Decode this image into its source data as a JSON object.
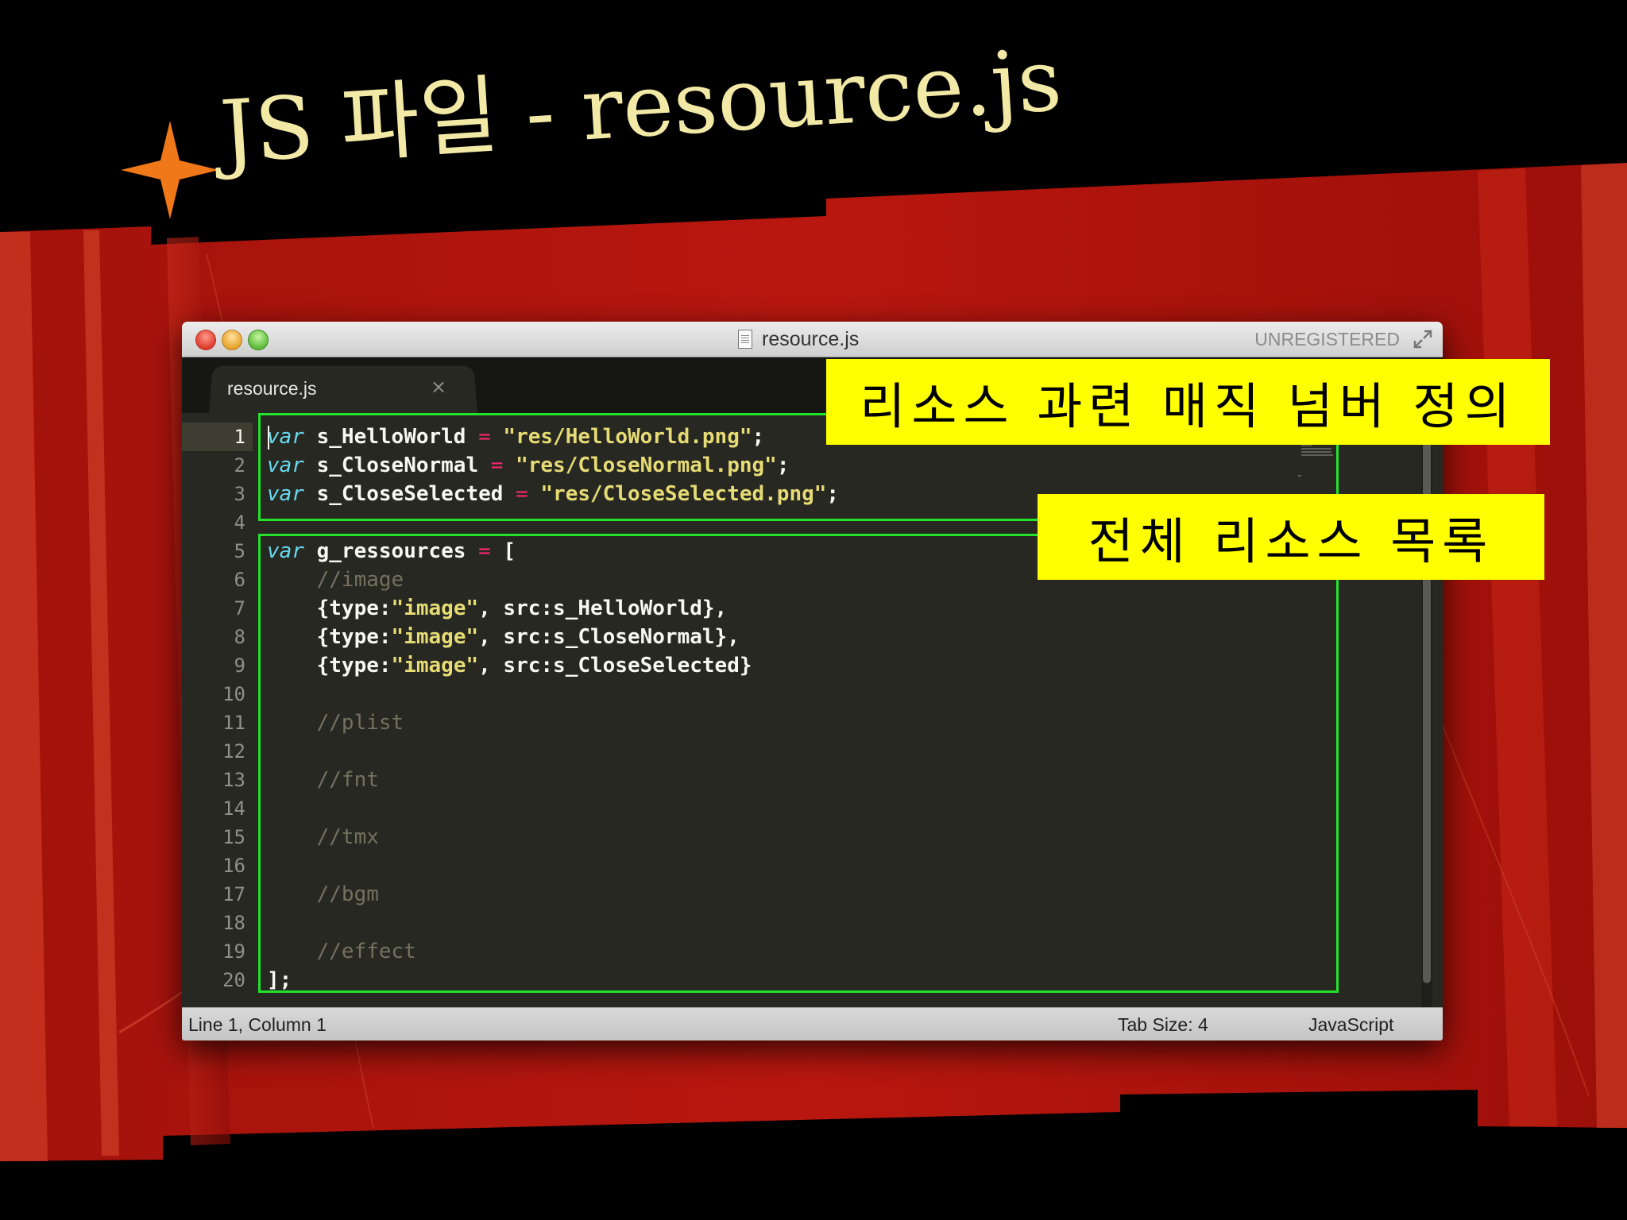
{
  "slide": {
    "title": "JS 파일 - resource.js"
  },
  "window": {
    "title": "resource.js",
    "registration": "UNREGISTERED"
  },
  "tab": {
    "label": "resource.js",
    "close": "×"
  },
  "editor": {
    "line_numbers": [
      "1",
      "2",
      "3",
      "4",
      "5",
      "6",
      "7",
      "8",
      "9",
      "10",
      "11",
      "12",
      "13",
      "14",
      "15",
      "16",
      "17",
      "18",
      "19",
      "20"
    ],
    "current_line": 1
  },
  "code": {
    "l1": {
      "kw": "var",
      "name": " s_HelloWorld ",
      "eq": "=",
      "str": " \"res/HelloWorld.png\"",
      "end": ";"
    },
    "l2": {
      "kw": "var",
      "name": " s_CloseNormal ",
      "eq": "=",
      "str": " \"res/CloseNormal.png\"",
      "end": ";"
    },
    "l3": {
      "kw": "var",
      "name": " s_CloseSelected ",
      "eq": "=",
      "str": " \"res/CloseSelected.png\"",
      "end": ";"
    },
    "l5": {
      "kw": "var",
      "name": " g_ressources ",
      "eq": "=",
      "end": " ["
    },
    "l6": "    //image",
    "l7": {
      "pre": "    {type:",
      "str": "\"image\"",
      "post": ", src:s_HelloWorld},"
    },
    "l8": {
      "pre": "    {type:",
      "str": "\"image\"",
      "post": ", src:s_CloseNormal},"
    },
    "l9": {
      "pre": "    {type:",
      "str": "\"image\"",
      "post": ", src:s_CloseSelected}"
    },
    "l11": "    //plist",
    "l13": "    //fnt",
    "l15": "    //tmx",
    "l17": "    //bgm",
    "l19": "    //effect",
    "l20": "];"
  },
  "status": {
    "position": "Line 1, Column 1",
    "tab_size": "Tab Size: 4",
    "syntax": "JavaScript"
  },
  "annotations": {
    "magic_numbers": "리소스 과련 매직 넘버 정의",
    "resource_list": "전체 리소스 목록",
    "highlight_color": "#22e22a",
    "label_color": "#ffff00"
  },
  "colors": {
    "title_text": "#f3e9a6",
    "star": "#f07818",
    "curtain_red": "#b3140d",
    "editor_bg": "#272822"
  }
}
